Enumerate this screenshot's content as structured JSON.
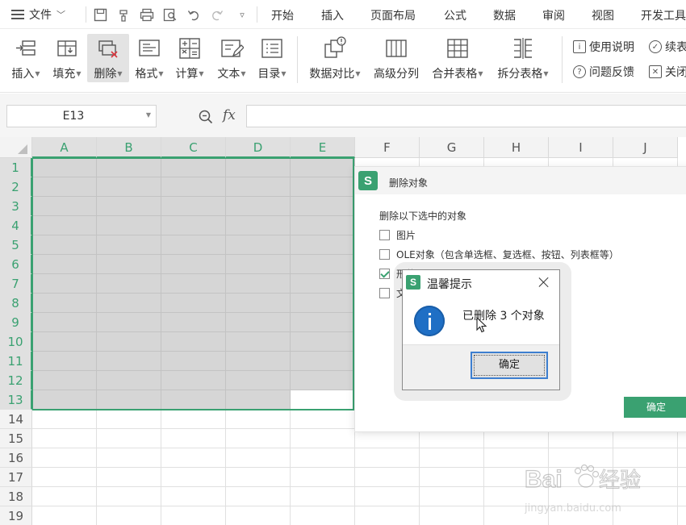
{
  "menu": {
    "file_label": "文件",
    "tabs": [
      "开始",
      "插入",
      "页面布局",
      "公式",
      "数据",
      "审阅",
      "视图",
      "开发工具"
    ]
  },
  "ribbon": {
    "buttons": [
      "插入",
      "填充",
      "删除",
      "格式",
      "计算",
      "文本",
      "目录",
      "数据对比",
      "高级分列",
      "合并表格",
      "拆分表格"
    ],
    "right": [
      "使用说明",
      "续表",
      "问题反馈",
      "关闭"
    ]
  },
  "formula": {
    "cell_ref": "E13",
    "fx": "fx",
    "value": ""
  },
  "sheet": {
    "columns": [
      "A",
      "B",
      "C",
      "D",
      "E",
      "F",
      "G",
      "H",
      "I",
      "J"
    ],
    "rows": [
      "1",
      "2",
      "3",
      "4",
      "5",
      "6",
      "7",
      "8",
      "9",
      "10",
      "11",
      "12",
      "13",
      "14",
      "15",
      "16",
      "17",
      "18",
      "19"
    ]
  },
  "delete_dialog": {
    "logo": "S",
    "title": "删除对象",
    "prompt": "删除以下选中的对象",
    "options": [
      {
        "label": "图片",
        "checked": false
      },
      {
        "label": "OLE对象（包含单选框、复选框、按钮、列表框等）",
        "checked": false
      },
      {
        "label": "形状",
        "checked": true
      },
      {
        "label": "文",
        "checked": false
      }
    ],
    "ok": "确定"
  },
  "message_box": {
    "logo": "S",
    "title": "温馨提示",
    "message": "已删除 3 个对象",
    "ok": "确定"
  },
  "watermark": {
    "brand": "Bai",
    "brand2": "经验",
    "url": "jingyan.baidu.com"
  },
  "colors": {
    "accent": "#3aa171",
    "selection": "#d6d6d6",
    "info": "#1f6fc5"
  }
}
